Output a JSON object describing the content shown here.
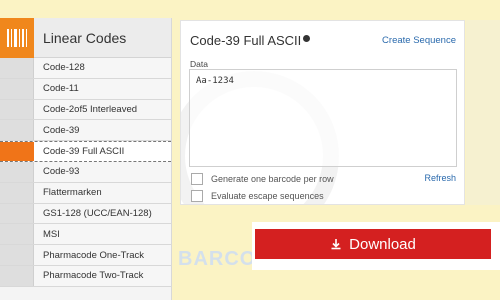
{
  "sidebar": {
    "header_title": "Linear Codes",
    "items": [
      {
        "label": "Code-128"
      },
      {
        "label": "Code-11"
      },
      {
        "label": "Code-2of5 Interleaved"
      },
      {
        "label": "Code-39"
      },
      {
        "label": "Code-39 Full ASCII",
        "active": true
      },
      {
        "label": "Code-93"
      },
      {
        "label": "Flattermarken"
      },
      {
        "label": "GS1-128 (UCC/EAN-128)"
      },
      {
        "label": "MSI"
      },
      {
        "label": "Pharmacode One-Track"
      },
      {
        "label": "Pharmacode Two-Track"
      }
    ]
  },
  "panel": {
    "title": "Code-39 Full ASCII",
    "create_sequence": "Create Sequence",
    "data_label": "Data",
    "data_value": "Aa-1234",
    "generate_per_row": "Generate one barcode per row",
    "refresh": "Refresh",
    "evaluate_escape": "Evaluate escape sequences"
  },
  "download": {
    "label": "Download",
    "color": "#d42020"
  },
  "watermark": "BARCODE WORLD",
  "colors": {
    "accent": "#f07418",
    "link": "#2a6aad",
    "background": "#fbf3c4"
  }
}
